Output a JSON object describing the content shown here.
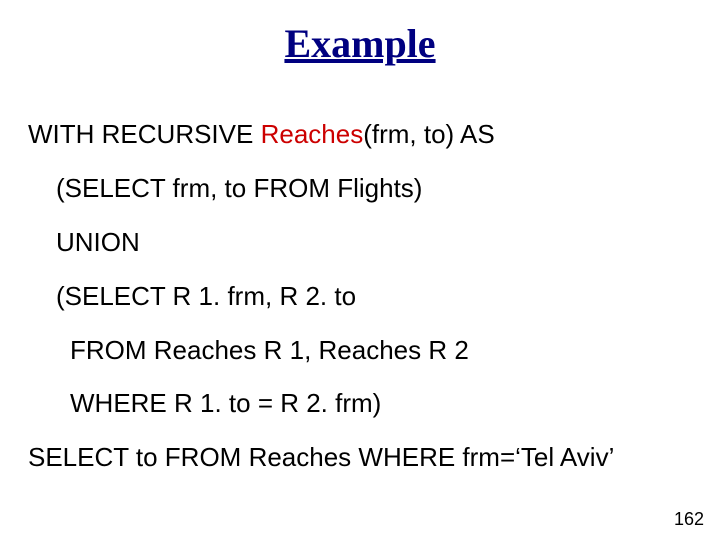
{
  "title": "Example",
  "lines": {
    "l1a": "WITH RECURSIVE ",
    "l1b": "Reaches",
    "l1c": "(frm, to) AS",
    "l2": "(SELECT frm, to FROM Flights)",
    "l3": "UNION",
    "l4": "(SELECT R 1. frm, R 2. to",
    "l5": "FROM Reaches R 1, Reaches R 2",
    "l6": "WHERE R 1. to = R 2. frm)",
    "l7": "SELECT to FROM Reaches WHERE frm=‘Tel Aviv’"
  },
  "page_number": "162"
}
